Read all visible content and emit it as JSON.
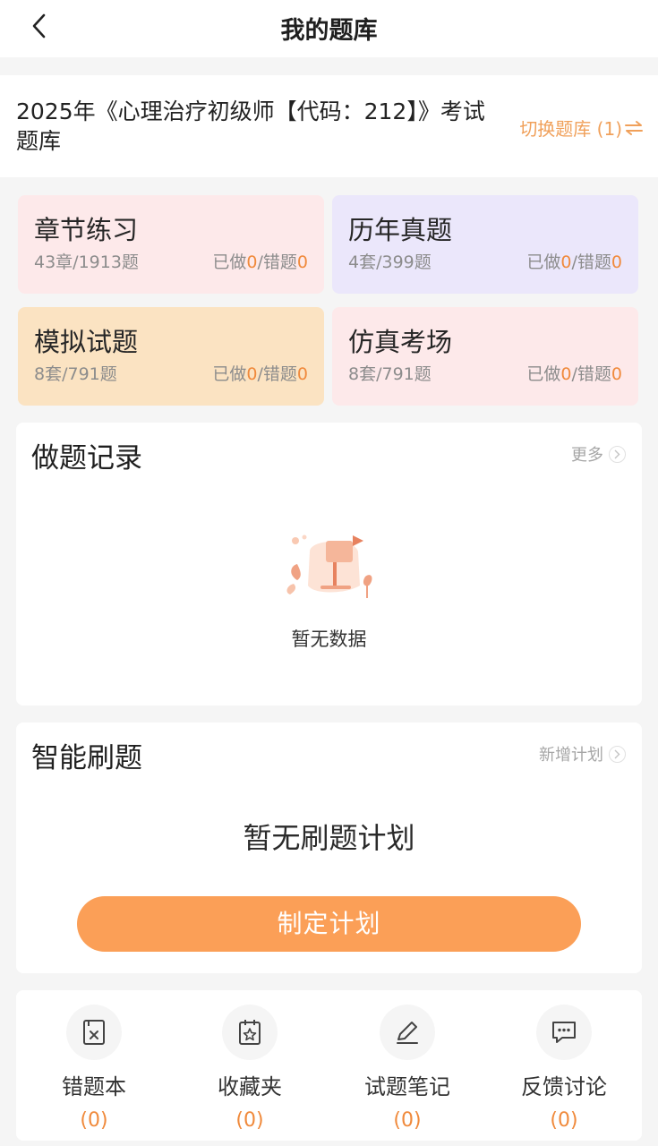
{
  "nav": {
    "title": "我的题库"
  },
  "bank": {
    "name": "2025年《心理治疗初级师【代码：212】》考试题库",
    "switch_label": "切换题库 (1)"
  },
  "cards": [
    {
      "title": "章节练习",
      "count": "43章/1913题",
      "done_label": "已做",
      "done": "0",
      "wrong_label": "/错题",
      "wrong": "0",
      "bg": "#fde9ea"
    },
    {
      "title": "历年真题",
      "count": "4套/399题",
      "done_label": "已做",
      "done": "0",
      "wrong_label": "/错题",
      "wrong": "0",
      "bg": "#ebe7fb"
    },
    {
      "title": "模拟试题",
      "count": "8套/791题",
      "done_label": "已做",
      "done": "0",
      "wrong_label": "/错题",
      "wrong": "0",
      "bg": "#fbe3c2"
    },
    {
      "title": "仿真考场",
      "count": "8套/791题",
      "done_label": "已做",
      "done": "0",
      "wrong_label": "/错题",
      "wrong": "0",
      "bg": "#fde9ea"
    }
  ],
  "records": {
    "title": "做题记录",
    "more": "更多",
    "empty_text": "暂无数据"
  },
  "plan": {
    "title": "智能刷题",
    "add": "新增计划",
    "empty_text": "暂无刷题计划",
    "button": "制定计划"
  },
  "tools": [
    {
      "label": "错题本",
      "count": "(0)",
      "icon": "wrong-book-icon"
    },
    {
      "label": "收藏夹",
      "count": "(0)",
      "icon": "favorites-icon"
    },
    {
      "label": "试题笔记",
      "count": "(0)",
      "icon": "pencil-icon"
    },
    {
      "label": "反馈讨论",
      "count": "(0)",
      "icon": "chat-bubble-icon"
    }
  ],
  "colors": {
    "accent": "#fb9f57",
    "orange_text": "#f08a3c",
    "switch": "#f0a05a"
  }
}
